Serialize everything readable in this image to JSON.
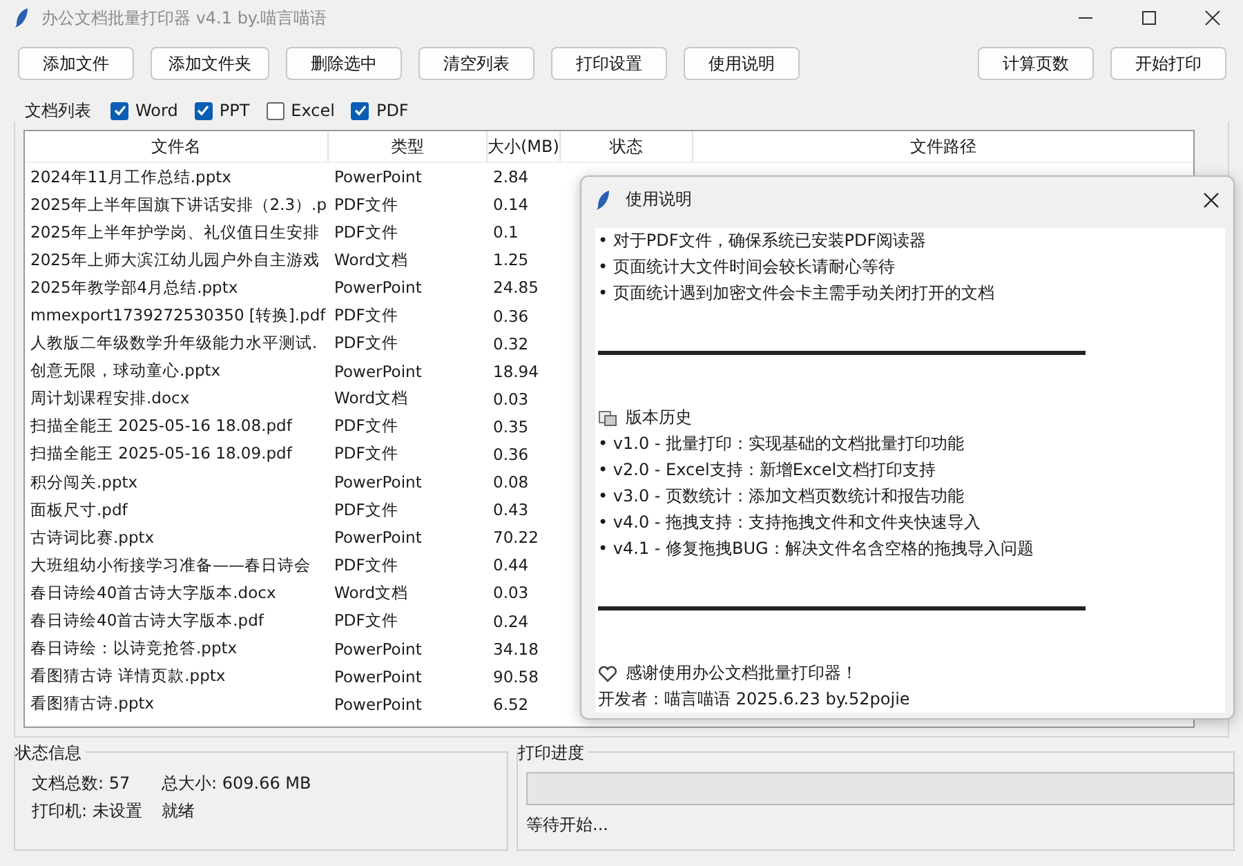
{
  "window": {
    "title": "办公文档批量打印器 v4.1 by.喵言喵语"
  },
  "toolbar": {
    "left": [
      "添加文件",
      "添加文件夹",
      "删除选中",
      "清空列表",
      "打印设置",
      "使用说明"
    ],
    "right": [
      "计算页数",
      "开始打印"
    ]
  },
  "file_list": {
    "label": "文档列表",
    "filters": [
      {
        "label": "Word",
        "checked": true
      },
      {
        "label": "PPT",
        "checked": true
      },
      {
        "label": "Excel",
        "checked": false
      },
      {
        "label": "PDF",
        "checked": true
      }
    ],
    "columns": [
      "文件名",
      "类型",
      "大小(MB)",
      "状态",
      "文件路径"
    ],
    "rows": [
      {
        "name": "2024年11月工作总结.pptx",
        "type": "PowerPoint",
        "size": "2.84"
      },
      {
        "name": "2025年上半年国旗下讲话安排（2.3）.p",
        "type": "PDF文件",
        "size": "0.14"
      },
      {
        "name": "2025年上半年护学岗、礼仪值日生安排",
        "type": "PDF文件",
        "size": "0.1"
      },
      {
        "name": "2025年上师大滨江幼儿园户外自主游戏",
        "type": "Word文档",
        "size": "1.25"
      },
      {
        "name": "2025年教学部4月总结.pptx",
        "type": "PowerPoint",
        "size": "24.85"
      },
      {
        "name": "mmexport1739272530350 [转换].pdf",
        "type": "PDF文件",
        "size": "0.36"
      },
      {
        "name": "人教版二年级数学升年级能力水平测试.",
        "type": "PDF文件",
        "size": "0.32"
      },
      {
        "name": "创意无限，球动童心.pptx",
        "type": "PowerPoint",
        "size": "18.94"
      },
      {
        "name": "周计划课程安排.docx",
        "type": "Word文档",
        "size": "0.03"
      },
      {
        "name": "扫描全能王 2025-05-16 18.08.pdf",
        "type": "PDF文件",
        "size": "0.35"
      },
      {
        "name": "扫描全能王 2025-05-16 18.09.pdf",
        "type": "PDF文件",
        "size": "0.36"
      },
      {
        "name": "积分闯关.pptx",
        "type": "PowerPoint",
        "size": "0.08"
      },
      {
        "name": "面板尺寸.pdf",
        "type": "PDF文件",
        "size": "0.43"
      },
      {
        "name": "古诗词比赛.pptx",
        "type": "PowerPoint",
        "size": "70.22"
      },
      {
        "name": "大班组幼小衔接学习准备——春日诗会",
        "type": "PDF文件",
        "size": "0.44"
      },
      {
        "name": "春日诗绘40首古诗大字版本.docx",
        "type": "Word文档",
        "size": "0.03"
      },
      {
        "name": "春日诗绘40首古诗大字版本.pdf",
        "type": "PDF文件",
        "size": "0.24"
      },
      {
        "name": "春日诗绘：以诗竞抢答.pptx",
        "type": "PowerPoint",
        "size": "34.18"
      },
      {
        "name": "看图猜古诗 详情页款.pptx",
        "type": "PowerPoint",
        "size": "90.58"
      },
      {
        "name": "看图猜古诗.pptx",
        "type": "PowerPoint",
        "size": "6.52"
      }
    ]
  },
  "dialog": {
    "title": "使用说明",
    "tips": [
      "• 对于PDF文件，确保系统已安装PDF阅读器",
      "• 页面统计大文件时间会较长请耐心等待",
      "• 页面统计遇到加密文件会卡主需手动关闭打开的文档"
    ],
    "history_title": "版本历史",
    "history": [
      "• v1.0 - 批量打印：实现基础的文档批量打印功能",
      "• v2.0 - Excel支持：新增Excel文档打印支持",
      "• v3.0 - 页数统计：添加文档页数统计和报告功能",
      "• v4.0 - 拖拽支持：支持拖拽文件和文件夹快速导入",
      "• v4.1 - 修复拖拽BUG：解决文件名含空格的拖拽导入问题"
    ],
    "thanks": "感谢使用办公文档批量打印器！",
    "developer": "开发者：喵言喵语 2025.6.23 by.52pojie"
  },
  "status_info": {
    "title": "状态信息",
    "total": "文档总数: 57",
    "size": "总大小: 609.66 MB",
    "printer": "打印机: 未设置",
    "state": "就绪"
  },
  "print_progress": {
    "title": "打印进度",
    "level": 0,
    "status": "等待开始..."
  }
}
